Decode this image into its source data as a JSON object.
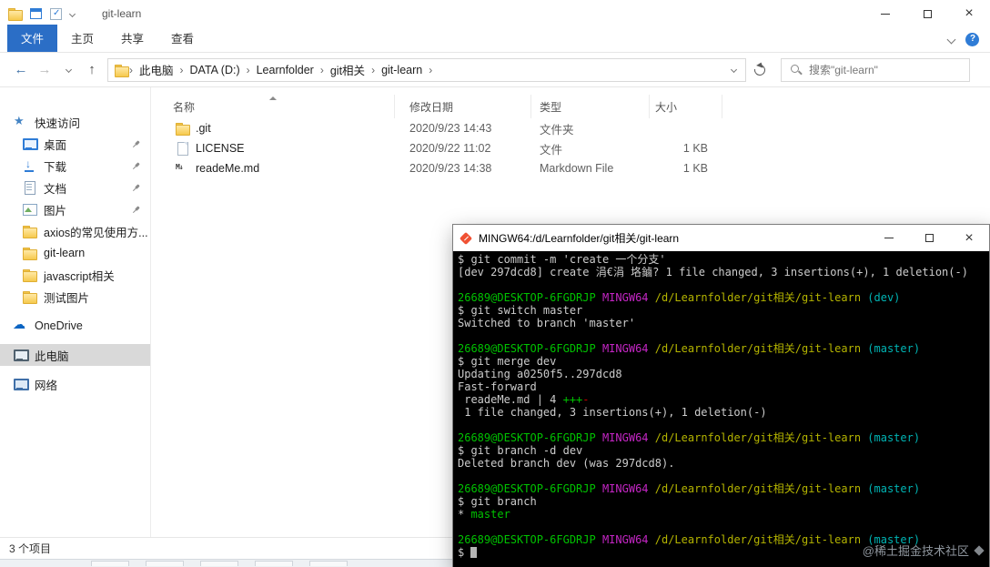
{
  "explorer": {
    "titlebar": {
      "title": "git-learn"
    },
    "ribbon": {
      "tabs": [
        {
          "key": "file",
          "label": "文件",
          "active": true
        },
        {
          "key": "home",
          "label": "主页",
          "active": false
        },
        {
          "key": "share",
          "label": "共享",
          "active": false
        },
        {
          "key": "view",
          "label": "查看",
          "active": false
        }
      ]
    },
    "navbar": {
      "breadcrumb": [
        "此电脑",
        "DATA (D:)",
        "Learnfolder",
        "git相关",
        "git-learn"
      ],
      "separator": "›",
      "search_placeholder": "搜索\"git-learn\""
    },
    "sidebar": {
      "items": [
        {
          "key": "quick-access",
          "label": "快速访问",
          "icon": "star",
          "child": false
        },
        {
          "key": "desktop",
          "label": "桌面",
          "icon": "desktop",
          "child": true,
          "pinned": true
        },
        {
          "key": "downloads",
          "label": "下载",
          "icon": "download",
          "child": true,
          "pinned": true
        },
        {
          "key": "documents",
          "label": "文档",
          "icon": "document",
          "child": true,
          "pinned": true
        },
        {
          "key": "pictures",
          "label": "图片",
          "icon": "pictures",
          "child": true,
          "pinned": true
        },
        {
          "key": "axios-folder",
          "label": "axios的常见使用方...",
          "icon": "folder",
          "child": true
        },
        {
          "key": "git-learn-folder",
          "label": "git-learn",
          "icon": "folder",
          "child": true
        },
        {
          "key": "javascript-folder",
          "label": "javascript相关",
          "icon": "folder",
          "child": true
        },
        {
          "key": "test-images-folder",
          "label": "测试图片",
          "icon": "folder",
          "child": true
        },
        {
          "key": "onedrive",
          "label": "OneDrive",
          "icon": "onedrive",
          "group": true
        },
        {
          "key": "this-pc",
          "label": "此电脑",
          "icon": "computer",
          "group": true,
          "selected": true
        },
        {
          "key": "network",
          "label": "网络",
          "icon": "network",
          "group": true
        }
      ]
    },
    "file_list": {
      "columns": [
        {
          "key": "name",
          "label": "名称",
          "sorted": "asc"
        },
        {
          "key": "date",
          "label": "修改日期"
        },
        {
          "key": "type",
          "label": "类型"
        },
        {
          "key": "size",
          "label": "大小"
        }
      ],
      "rows": [
        {
          "icon": "folder",
          "name": ".git",
          "date": "2020/9/23 14:43",
          "type": "文件夹",
          "size": ""
        },
        {
          "icon": "file",
          "name": "LICENSE",
          "date": "2020/9/22 11:02",
          "type": "文件",
          "size": "1 KB"
        },
        {
          "icon": "markdown",
          "name": "readeMe.md",
          "date": "2020/9/23 14:38",
          "type": "Markdown File",
          "size": "1 KB"
        }
      ]
    },
    "statusbar": {
      "items_count": "3 个项目"
    }
  },
  "terminal": {
    "title": "MINGW64:/d/Learnfolder/git相关/git-learn",
    "colors": {
      "bg": "#000000",
      "fg": "#cccccc",
      "green": "#00c200",
      "magenta": "#c526c5",
      "yellow": "#b4b400",
      "cyan": "#00b4b4",
      "red": "#c80000"
    },
    "lines": [
      [
        {
          "t": "$ git commit -m 'create 一个分支'",
          "c": "fg"
        }
      ],
      [
        {
          "t": "[dev 297dcd8] create 涓€涓 垎鏀? 1 file changed, 3 insertions(+), 1 deletion(-)",
          "c": "fg"
        }
      ],
      [],
      [
        {
          "t": "26689@DESKTOP-6FGDRJP ",
          "c": "green"
        },
        {
          "t": "MINGW64 ",
          "c": "magenta"
        },
        {
          "t": "/d/Learnfolder/git相关/git-learn ",
          "c": "yellow"
        },
        {
          "t": "(dev)",
          "c": "cyan"
        }
      ],
      [
        {
          "t": "$ git switch master",
          "c": "fg"
        }
      ],
      [
        {
          "t": "Switched to branch 'master'",
          "c": "fg"
        }
      ],
      [],
      [
        {
          "t": "26689@DESKTOP-6FGDRJP ",
          "c": "green"
        },
        {
          "t": "MINGW64 ",
          "c": "magenta"
        },
        {
          "t": "/d/Learnfolder/git相关/git-learn ",
          "c": "yellow"
        },
        {
          "t": "(master)",
          "c": "cyan"
        }
      ],
      [
        {
          "t": "$ git merge dev",
          "c": "fg"
        }
      ],
      [
        {
          "t": "Updating a0250f5..297dcd8",
          "c": "fg"
        }
      ],
      [
        {
          "t": "Fast-forward",
          "c": "fg"
        }
      ],
      [
        {
          "t": " readeMe.md | 4 ",
          "c": "fg"
        },
        {
          "t": "+++",
          "c": "green"
        },
        {
          "t": "-",
          "c": "red"
        }
      ],
      [
        {
          "t": " 1 file changed, 3 insertions(+), 1 deletion(-)",
          "c": "fg"
        }
      ],
      [],
      [
        {
          "t": "26689@DESKTOP-6FGDRJP ",
          "c": "green"
        },
        {
          "t": "MINGW64 ",
          "c": "magenta"
        },
        {
          "t": "/d/Learnfolder/git相关/git-learn ",
          "c": "yellow"
        },
        {
          "t": "(master)",
          "c": "cyan"
        }
      ],
      [
        {
          "t": "$ git branch -d dev",
          "c": "fg"
        }
      ],
      [
        {
          "t": "Deleted branch dev (was 297dcd8).",
          "c": "fg"
        }
      ],
      [],
      [
        {
          "t": "26689@DESKTOP-6FGDRJP ",
          "c": "green"
        },
        {
          "t": "MINGW64 ",
          "c": "magenta"
        },
        {
          "t": "/d/Learnfolder/git相关/git-learn ",
          "c": "yellow"
        },
        {
          "t": "(master)",
          "c": "cyan"
        }
      ],
      [
        {
          "t": "$ git branch",
          "c": "fg"
        }
      ],
      [
        {
          "t": "* ",
          "c": "fg"
        },
        {
          "t": "master",
          "c": "green"
        }
      ],
      [],
      [
        {
          "t": "26689@DESKTOP-6FGDRJP ",
          "c": "green"
        },
        {
          "t": "MINGW64 ",
          "c": "magenta"
        },
        {
          "t": "/d/Learnfolder/git相关/git-learn ",
          "c": "yellow"
        },
        {
          "t": "(master)",
          "c": "cyan"
        }
      ],
      [
        {
          "t": "$ ",
          "c": "fg"
        },
        {
          "t": "",
          "c": "cursor"
        }
      ]
    ]
  },
  "watermark": {
    "text": "@稀土掘金技术社区"
  }
}
